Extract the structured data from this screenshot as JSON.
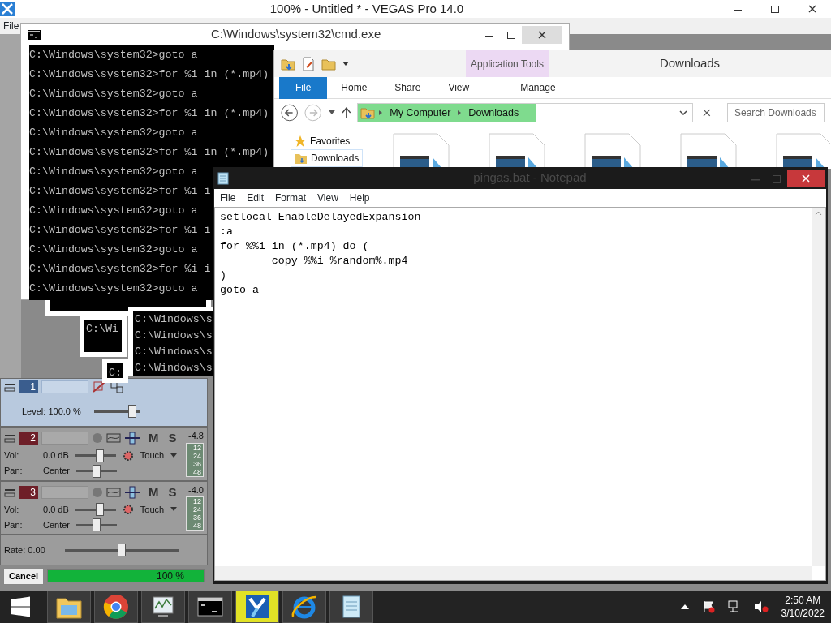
{
  "vegas": {
    "title": "100% - Untitled * - VEGAS Pro 14.0",
    "menu": [
      {
        "label": "File"
      }
    ],
    "tracks": [
      {
        "kind": "video",
        "number": "1",
        "selected": true,
        "fader": {
          "label": "Level: 100.0 %",
          "level": 0.85
        }
      },
      {
        "kind": "audio",
        "number": "2",
        "selected": false,
        "mute": "M",
        "solo": "S",
        "peak": "-4.8",
        "meter_ticks": [
          "12",
          "24",
          "36",
          "48"
        ],
        "automation": "Touch",
        "volume": {
          "label": "Vol:",
          "value": "0.0 dB",
          "level": 0.6
        },
        "pan": {
          "label": "Pan:",
          "value": "Center",
          "level": 0.5
        }
      },
      {
        "kind": "audio",
        "number": "3",
        "selected": false,
        "mute": "M",
        "solo": "S",
        "peak": "-4.0",
        "meter_ticks": [
          "12",
          "24",
          "36",
          "48"
        ],
        "automation": "Touch",
        "volume": {
          "label": "Vol:",
          "value": "0.0 dB",
          "level": 0.6
        },
        "pan": {
          "label": "Pan:",
          "value": "Center",
          "level": 0.5
        }
      }
    ],
    "rate": {
      "label": "Rate: 0.00",
      "level": 0.5
    },
    "cancel": "Cancel",
    "progress": {
      "text": "100 %",
      "level": 1
    }
  },
  "cmd": {
    "title": "C:\\Windows\\system32\\cmd.exe",
    "lines": [
      "C:\\Windows\\system32>goto a",
      "C:\\Windows\\system32>for %i in (*.mp4)",
      "C:\\Windows\\system32>goto a",
      "C:\\Windows\\system32>for %i in (*.mp4)",
      "C:\\Windows\\system32>goto a",
      "C:\\Windows\\system32>for %i in (*.mp4)",
      "C:\\Windows\\system32>goto a",
      "C:\\Windows\\system32>for %i i",
      "C:\\Windows\\system32>goto a",
      "C:\\Windows\\system32>for %i i",
      "C:\\Windows\\system32>goto a",
      "C:\\Windows\\system32>for %i i",
      "C:\\Windows\\system32>goto a"
    ]
  },
  "cmd_trails": [
    {
      "lines": [
        "C:\\Wi"
      ]
    },
    {
      "lines": [
        "C:"
      ]
    },
    {
      "lines": [
        "C:\\Windows\\s",
        "C:\\Windows\\s",
        "C:\\Windows\\s",
        "C:\\Windows\\s"
      ]
    }
  ],
  "explorer": {
    "title": "Downloads",
    "context_tab": "Application Tools",
    "tabs": [
      {
        "label": "File",
        "kind": "backstage",
        "selected": false
      },
      {
        "label": "Home",
        "kind": "tab",
        "selected": false
      },
      {
        "label": "Share",
        "kind": "tab",
        "selected": false
      },
      {
        "label": "View",
        "kind": "tab",
        "selected": false
      },
      {
        "label": "Manage",
        "kind": "tab",
        "selected": false
      }
    ],
    "breadcrumb": [
      "My Computer",
      "Downloads"
    ],
    "address_progress": {
      "level": 0.53
    },
    "search": {
      "placeholder": "Search Downloads"
    },
    "nav": [
      {
        "label": "Favorites",
        "kind": "group",
        "selected": false
      },
      {
        "label": "Downloads",
        "kind": "folder",
        "selected": true
      }
    ]
  },
  "notepad": {
    "title": "pingas.bat - Notepad",
    "menu": [
      "File",
      "Edit",
      "Format",
      "View",
      "Help"
    ],
    "lines": [
      "setlocal EnableDelayedExpansion",
      ":a",
      "for %%i in (*.mp4) do (",
      "\tcopy %%i %random%.mp4",
      ")",
      "goto a"
    ]
  },
  "taskbar": {
    "apps": [
      {
        "kind": "explorer",
        "active": false
      },
      {
        "kind": "browser",
        "active": false
      },
      {
        "kind": "monitor",
        "active": false
      },
      {
        "kind": "console",
        "active": false
      },
      {
        "kind": "vegas",
        "active": true
      },
      {
        "kind": "ie",
        "active": false
      },
      {
        "kind": "notepad",
        "active": false
      }
    ],
    "clock": {
      "time": "2:50 AM",
      "date": "3/10/2022"
    }
  }
}
